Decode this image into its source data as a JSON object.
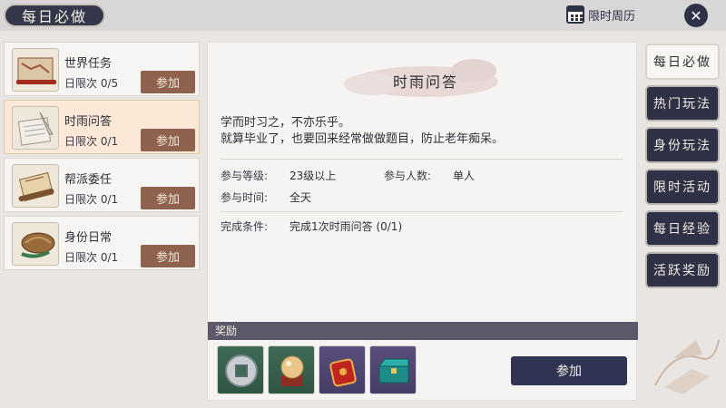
{
  "header": {
    "title": "每日必做",
    "calendar_label": "限时周历",
    "close_symbol": "✕"
  },
  "tasks": [
    {
      "name": "世界任务",
      "limit": "日限次  0/5",
      "join": "参加",
      "icon": "map-scroll-icon"
    },
    {
      "name": "时雨问答",
      "limit": "日限次  0/1",
      "join": "参加",
      "icon": "quill-paper-icon"
    },
    {
      "name": "帮派委任",
      "limit": "日限次  0/1",
      "join": "参加",
      "icon": "scroll-icon"
    },
    {
      "name": "身份日常",
      "limit": "日限次  0/1",
      "join": "参加",
      "icon": "basket-hat-icon"
    }
  ],
  "detail": {
    "title": "时雨问答",
    "desc_line1": "学而时习之，不亦乐乎。",
    "desc_line2": "就算毕业了，也要回来经常做做题目，防止老年痴呆。",
    "level_label": "参与等级:",
    "level_value": "23级以上",
    "people_label": "参与人数:",
    "people_value": "单人",
    "time_label": "参与时间:",
    "time_value": "全天",
    "cond_label": "完成条件:",
    "cond_value": "完成1次时雨问答 (0/1)",
    "reward_label": "奖励",
    "join": "参加",
    "rewards": [
      "coin-icon",
      "orb-icon",
      "red-pouch-icon",
      "jade-chest-icon"
    ]
  },
  "tabs": [
    {
      "label": "每日必做",
      "active": true
    },
    {
      "label": "热门玩法",
      "active": false
    },
    {
      "label": "身份玩法",
      "active": false
    },
    {
      "label": "限时活动",
      "active": false
    },
    {
      "label": "每日经验",
      "active": false
    },
    {
      "label": "活跃奖励",
      "active": false
    }
  ],
  "colors": {
    "navy": "#2f3246",
    "brown_button": "#8f6250",
    "active_card": "#fbe8d6",
    "reward_green": "#3f6b55",
    "reward_purple": "#5a4e7d"
  }
}
